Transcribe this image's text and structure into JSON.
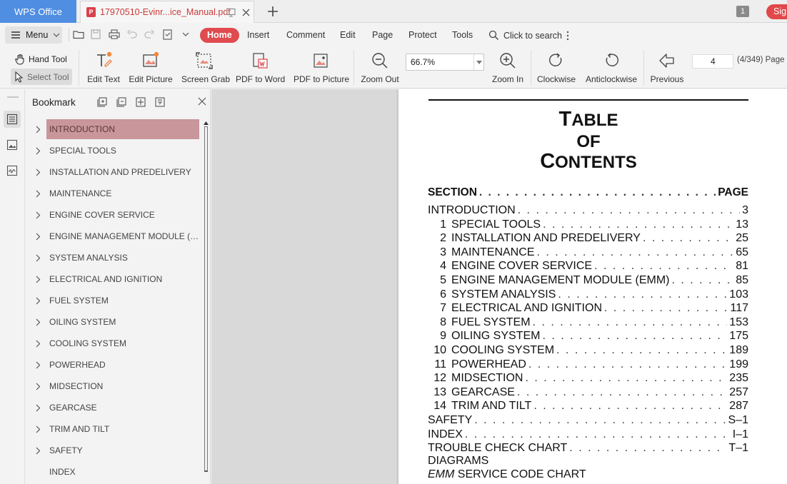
{
  "app": {
    "name": "WPS Office",
    "doc_tab_title": "17970510-Evinr...ice_Manual.pdf",
    "pdf_badge": "P",
    "window_count": "1",
    "sign_in": "Sign"
  },
  "menubar": {
    "menu_label": "Menu",
    "tabs": [
      "Home",
      "Insert",
      "Comment",
      "Edit",
      "Page",
      "Protect",
      "Tools"
    ],
    "search_label": "Click to search"
  },
  "toolbar": {
    "hand_tool": "Hand Tool",
    "select_tool": "Select Tool",
    "tools": [
      "Edit Text",
      "Edit Picture",
      "Screen Grab",
      "PDF to Word",
      "PDF to Picture",
      "Zoom Out"
    ],
    "zoom_value": "66.7%",
    "zoom_in": "Zoom In",
    "clockwise": "Clockwise",
    "anticlockwise": "Anticlockwise",
    "previous": "Previous",
    "page_value": "4",
    "page_total": "(4/349) Page"
  },
  "bookmark": {
    "title": "Bookmark",
    "items": [
      "INTRODUCTION",
      "SPECIAL TOOLS",
      "INSTALLATION AND PREDELIVERY",
      "MAINTENANCE",
      "ENGINE COVER SERVICE",
      "ENGINE MANAGEMENT MODULE (EM...",
      "SYSTEM ANALYSIS",
      "ELECTRICAL AND IGNITION",
      "FUEL SYSTEM",
      "OILING SYSTEM",
      "COOLING SYSTEM",
      "POWERHEAD",
      "MIDSECTION",
      "GEARCASE",
      "TRIM AND TILT",
      "SAFETY",
      "INDEX"
    ]
  },
  "document": {
    "heading_line1_cap": "T",
    "heading_line1_rest": "ABLE",
    "heading_line2": "OF",
    "heading_line3_cap": "C",
    "heading_line3_rest": "ONTENTS",
    "col_section": "SECTION",
    "col_page": "PAGE",
    "toc": [
      {
        "num": "",
        "title": "INTRODUCTION",
        "page": "3"
      },
      {
        "num": "1",
        "title": "SPECIAL TOOLS",
        "page": "13"
      },
      {
        "num": "2",
        "title": "INSTALLATION AND PREDELIVERY",
        "page": "25"
      },
      {
        "num": "3",
        "title": "MAINTENANCE",
        "page": "65"
      },
      {
        "num": "4",
        "title": "ENGINE COVER SERVICE",
        "page": "81"
      },
      {
        "num": "5",
        "title": "ENGINE MANAGEMENT MODULE (EMM)",
        "page": "85"
      },
      {
        "num": "6",
        "title": "SYSTEM ANALYSIS",
        "page": "103"
      },
      {
        "num": "7",
        "title": "ELECTRICAL AND IGNITION",
        "page": "117"
      },
      {
        "num": "8",
        "title": "FUEL SYSTEM",
        "page": "153"
      },
      {
        "num": "9",
        "title": "OILING SYSTEM",
        "page": "175"
      },
      {
        "num": "10",
        "title": "COOLING SYSTEM",
        "page": "189"
      },
      {
        "num": "11",
        "title": "POWERHEAD",
        "page": "199"
      },
      {
        "num": "12",
        "title": "MIDSECTION",
        "page": "235"
      },
      {
        "num": "13",
        "title": "GEARCASE",
        "page": "257"
      },
      {
        "num": "14",
        "title": "TRIM AND TILT",
        "page": "287"
      },
      {
        "num": "",
        "title": "SAFETY",
        "page": "S–1"
      },
      {
        "num": "",
        "title": "INDEX",
        "page": "I–1"
      },
      {
        "num": "",
        "title": "TROUBLE CHECK CHART",
        "page": "T–1"
      }
    ],
    "diagrams_label": "DIAGRAMS",
    "emm_italic": "EMM",
    "emm_rest": " SERVICE CODE CHART"
  },
  "colors": {
    "accent": "#df4b4e",
    "app_tab": "#4f8ee0",
    "bookmark_selected": "#c8969b"
  }
}
